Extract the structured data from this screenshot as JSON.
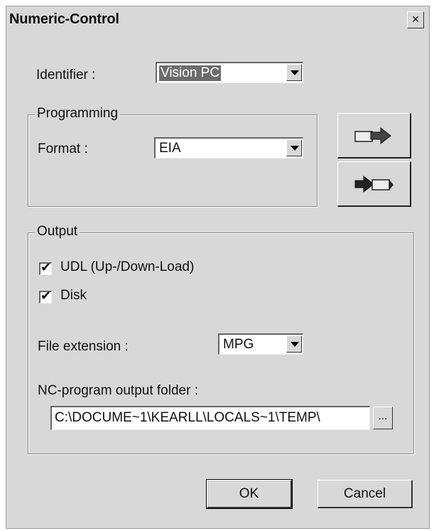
{
  "window": {
    "title": "Numeric-Control",
    "close_label": "×"
  },
  "identifier": {
    "label": "Identifier :",
    "value": "Vision PC"
  },
  "programming": {
    "group_label": "Programming",
    "format_label": "Format :",
    "format_value": "EIA"
  },
  "side_buttons": [
    {
      "icon": "export-arrow-icon"
    },
    {
      "icon": "import-arrow-icon"
    }
  ],
  "output": {
    "group_label": "Output",
    "udl": {
      "label": "UDL (Up-/Down-Load)",
      "checked": true,
      "mark": "✔"
    },
    "disk": {
      "label": "Disk",
      "checked": true,
      "mark": "✔"
    },
    "extension_label": "File extension :",
    "extension_value": "MPG",
    "folder_label": "NC-program output folder :",
    "folder_value": "C:\\DOCUME~1\\KEARLL\\LOCALS~1\\TEMP\\",
    "browse_label": "..."
  },
  "buttons": {
    "ok": "OK",
    "cancel": "Cancel"
  }
}
